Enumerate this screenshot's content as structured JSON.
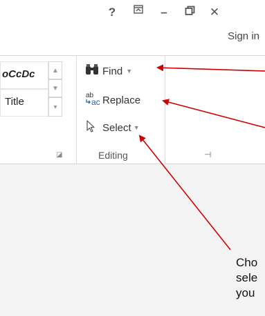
{
  "window": {
    "help_label": "?",
    "ribbon_display_label": "▣",
    "minimize_label": "–",
    "restore_label": "❐",
    "close_label": "✕",
    "sign_in": "Sign in"
  },
  "styles": {
    "items": [
      {
        "label": "oCcDc"
      },
      {
        "label": "Title"
      }
    ],
    "scroll_up": "▲",
    "scroll_down": "▼",
    "more": "▾",
    "launcher": "◪"
  },
  "editing": {
    "find_label": "Find",
    "find_arrow": "▼",
    "replace_label": "Replace",
    "select_label": "Select",
    "select_arrow": "▼",
    "group_label": "Editing",
    "pin": "⊣"
  },
  "annotation": {
    "lines": [
      "Cho",
      "sele",
      "you"
    ],
    "arrow_color": "#cc0000"
  }
}
